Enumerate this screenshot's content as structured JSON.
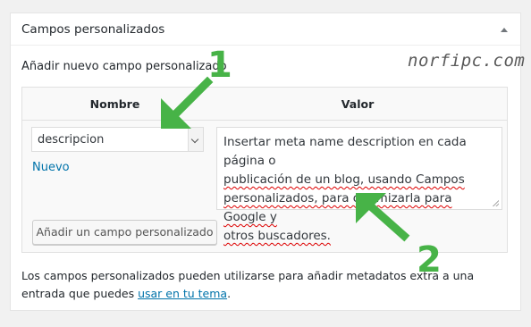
{
  "panel": {
    "title": "Campos personalizados"
  },
  "watermark": "norfipc.com",
  "add_heading": "Añadir nuevo campo personalizado",
  "table": {
    "name_header": "Nombre",
    "value_header": "Valor"
  },
  "name_select": {
    "value": "descripcion"
  },
  "new_link": "Nuevo",
  "value_textarea": {
    "lines": [
      "Insertar meta name description en cada página o",
      "publicación de un blog, usando Campos",
      "personalizados, para optimizarla para Google y",
      "otros buscadores."
    ]
  },
  "add_button_label": "Añadir un campo personalizado",
  "footer": {
    "text_before": "Los campos personalizados pueden utilizarse para añadir metadatos extra a una entrada que puedes ",
    "link": "usar en tu tema",
    "text_after": "."
  },
  "annotations": {
    "one": "1",
    "two": "2",
    "color": "#47b347"
  }
}
